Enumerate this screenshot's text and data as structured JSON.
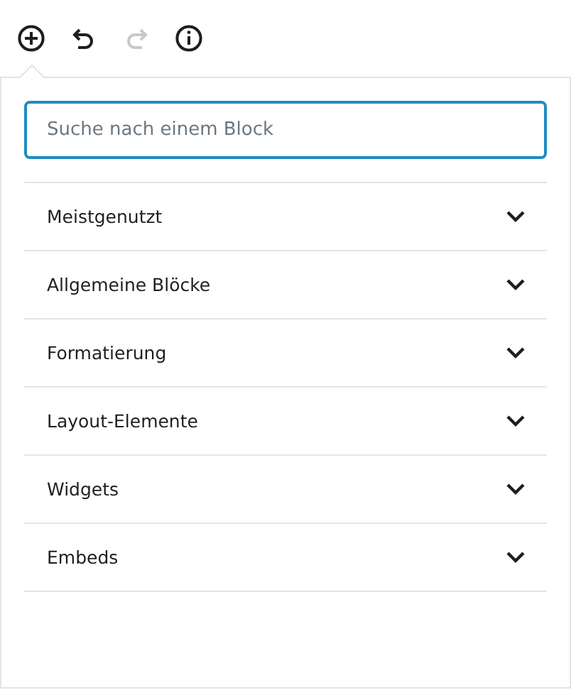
{
  "toolbar": [
    {
      "kind": "add",
      "disabled": false
    },
    {
      "kind": "undo",
      "disabled": false
    },
    {
      "kind": "redo",
      "disabled": true
    },
    {
      "kind": "info",
      "disabled": false
    }
  ],
  "search": {
    "placeholder": "Suche nach einem Block"
  },
  "categories": [
    {
      "label": "Meistgenutzt",
      "expanded": false
    },
    {
      "label": "Allgemeine Blöcke",
      "expanded": false
    },
    {
      "label": "Formatierung",
      "expanded": false
    },
    {
      "label": "Layout-Elemente",
      "expanded": false
    },
    {
      "label": "Widgets",
      "expanded": false
    },
    {
      "label": "Embeds",
      "expanded": false
    }
  ]
}
